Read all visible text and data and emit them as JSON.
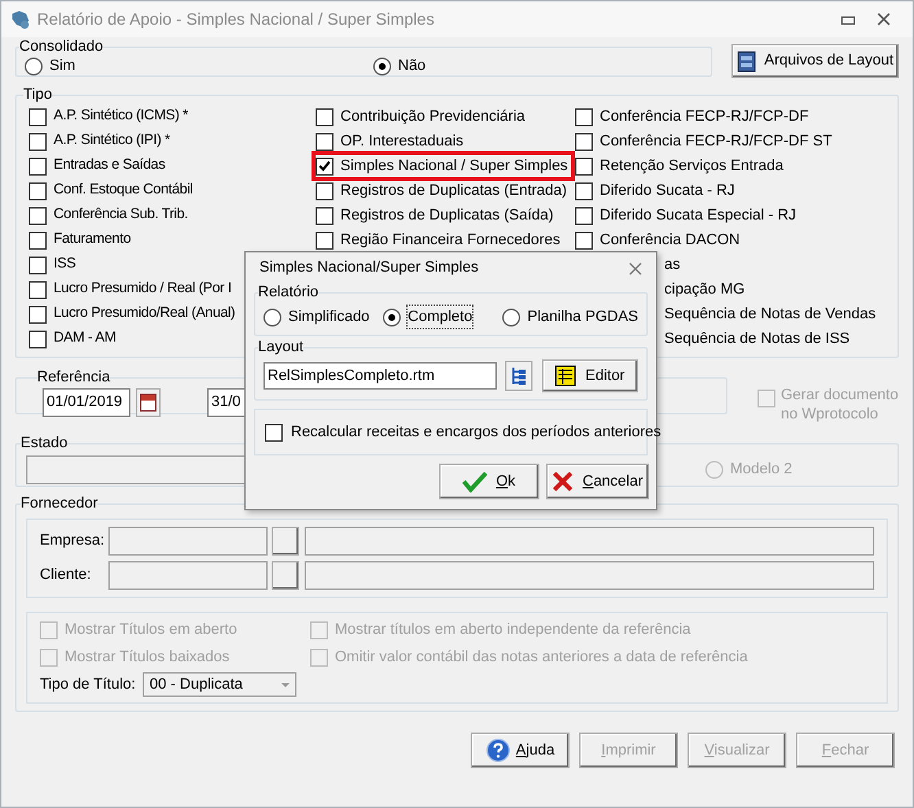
{
  "window": {
    "title": "Relatório de Apoio - Simples Nacional / Super Simples"
  },
  "consolidado": {
    "label": "Consolidado",
    "options": [
      {
        "label": "Sim",
        "selected": false
      },
      {
        "label": "Não",
        "selected": true
      }
    ]
  },
  "layout_files_button": "Arquivos de Layout",
  "tipo": {
    "label": "Tipo",
    "columns": [
      [
        {
          "kind": "checkbox",
          "label": "A.P. Sintético (ICMS) *",
          "checked": false
        },
        {
          "kind": "checkbox",
          "label": "A.P. Sintético (IPI) *",
          "checked": false
        },
        {
          "kind": "checkbox",
          "label": "Entradas e Saídas",
          "checked": false
        },
        {
          "kind": "checkbox",
          "label": "Conf. Estoque Contábil",
          "checked": false
        },
        {
          "kind": "checkbox",
          "label": "Conferência Sub. Trib.",
          "checked": false
        },
        {
          "kind": "checkbox",
          "label": "Faturamento",
          "checked": false
        },
        {
          "kind": "checkbox",
          "label": "ISS",
          "checked": false
        },
        {
          "kind": "checkbox",
          "label": "Lucro Presumido / Real (Por I",
          "checked": false
        },
        {
          "kind": "checkbox",
          "label": "Lucro Presumido/Real (Anual)",
          "checked": false
        },
        {
          "kind": "checkbox",
          "label": "DAM - AM",
          "checked": false
        }
      ],
      [
        {
          "kind": "checkbox",
          "label": "Contribuição Previdenciária",
          "checked": false
        },
        {
          "kind": "checkbox",
          "label": "OP. Interestaduais",
          "checked": false
        },
        {
          "kind": "checkbox",
          "label": "Simples Nacional / Super Simples",
          "checked": true,
          "highlighted": true
        },
        {
          "kind": "checkbox",
          "label": "Registros de Duplicatas (Entrada)",
          "checked": false
        },
        {
          "kind": "checkbox",
          "label": "Registros de Duplicatas (Saída)",
          "checked": false
        },
        {
          "kind": "checkbox",
          "label": "Região Financeira Fornecedores",
          "checked": false
        }
      ],
      [
        {
          "kind": "checkbox",
          "label": "Conferência FECP-RJ/FCP-DF",
          "checked": false
        },
        {
          "kind": "checkbox",
          "label": "Conferência FECP-RJ/FCP-DF ST",
          "checked": false
        },
        {
          "kind": "checkbox",
          "label": "Retenção Serviços Entrada",
          "checked": false
        },
        {
          "kind": "checkbox",
          "label": "Diferido Sucata - RJ",
          "checked": false
        },
        {
          "kind": "checkbox",
          "label": "Diferido Sucata Especial - RJ",
          "checked": false
        },
        {
          "kind": "checkbox",
          "label": "Conferência DACON",
          "checked": false
        },
        {
          "kind": "fragment",
          "label": "as"
        },
        {
          "kind": "fragment",
          "label": "cipação MG"
        },
        {
          "kind": "fragment",
          "label": "Sequência de Notas de Vendas"
        },
        {
          "kind": "fragment",
          "label": "Sequência de Notas de ISS"
        }
      ]
    ]
  },
  "referencia": {
    "label": "Referência",
    "start": "01/01/2019",
    "end": "31/0"
  },
  "gerar_documento": {
    "label": "Gerar documento no Wprotocolo",
    "checked": false,
    "disabled": true
  },
  "estado": {
    "label": "Estado",
    "modelo2": {
      "label": "Modelo 2",
      "selected": false,
      "disabled": true
    }
  },
  "fornecedor": {
    "label": "Fornecedor",
    "fields": [
      {
        "label": "Empresa:"
      },
      {
        "label": "Cliente:"
      }
    ],
    "options": [
      {
        "label": "Mostrar Títulos em aberto",
        "checked": false,
        "disabled": true
      },
      {
        "label": "Mostrar títulos em aberto independente da referência",
        "checked": false,
        "disabled": true
      },
      {
        "label": "Mostrar Títulos baixados",
        "checked": false,
        "disabled": true
      },
      {
        "label": "Omitir valor contábil das notas anteriores a data de referência",
        "checked": false,
        "disabled": true
      }
    ],
    "tipo_titulo": {
      "label": "Tipo de Título:",
      "value": "00 - Duplicata"
    }
  },
  "buttons": [
    {
      "label": "Ajuda",
      "kind": "help",
      "disabled": false
    },
    {
      "label": "Imprimir",
      "kind": "plain",
      "disabled": true
    },
    {
      "label": "Visualizar",
      "kind": "plain",
      "disabled": true
    },
    {
      "label": "Fechar",
      "kind": "plain",
      "disabled": true
    }
  ],
  "dialog": {
    "title": "Simples Nacional/Super Simples",
    "relatorio": {
      "label": "Relatório",
      "options": [
        {
          "label": "Simplificado",
          "selected": false
        },
        {
          "label": "Completo",
          "selected": true
        },
        {
          "label": "Planilha PGDAS",
          "selected": false
        }
      ]
    },
    "layout": {
      "label": "Layout",
      "value": "RelSimplesCompleto.rtm",
      "editor_button": "Editor"
    },
    "recalcular": {
      "label": "Recalcular receitas e encargos dos períodos anteriores",
      "checked": false
    },
    "buttons": [
      {
        "label": "Ok",
        "kind": "ok"
      },
      {
        "label": "Cancelar",
        "kind": "cancel"
      }
    ]
  }
}
